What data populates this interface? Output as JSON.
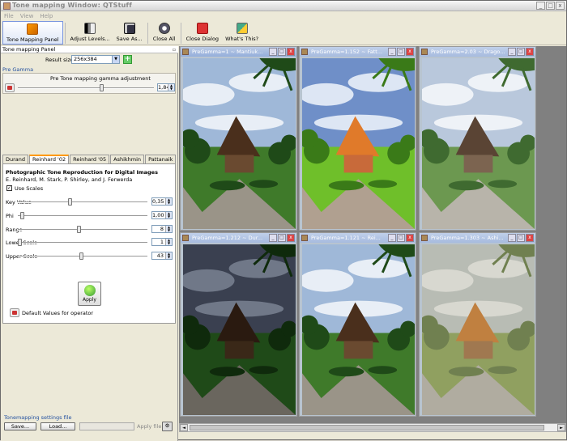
{
  "window": {
    "title": "Tone mapping Window: QTStuff"
  },
  "menu": [
    "File",
    "View",
    "Help"
  ],
  "toolbar": [
    {
      "label": "Tone Mapping Panel",
      "icon": "tonemap-panel-icon",
      "active": true
    },
    {
      "label": "Adjust Levels...",
      "icon": "levels-icon"
    },
    {
      "label": "Save As...",
      "icon": "save-icon"
    },
    {
      "label": "Close All",
      "icon": "close-all-icon"
    },
    {
      "label": "Close Dialog",
      "icon": "power-icon"
    },
    {
      "label": "What's This?",
      "icon": "whats-this-icon"
    }
  ],
  "panel": {
    "title": "Tone mapping Panel",
    "result_size_label": "Result size:",
    "result_size_value": "256x384",
    "pregamma_title": "Pre Gamma",
    "pregamma_caption": "Pre Tone mapping gamma adjustment",
    "pregamma_value": "1,848",
    "pregamma_level": 0.62
  },
  "tabs": [
    "Durand",
    "Reinhard '02",
    "Reinhard '05",
    "Ashikhmin",
    "Pattanaik"
  ],
  "operator": {
    "title": "Photographic Tone Reproduction for Digital Images",
    "authors": "E. Reinhard, M. Stark, P. Shirley, and J. Ferwerda",
    "use_scales": "Use Scales",
    "params": [
      {
        "label": "Key Value",
        "value": "0,35",
        "level": 0.4
      },
      {
        "label": "Phi",
        "value": "1,00",
        "level": 0.02
      },
      {
        "label": "Range",
        "value": "8",
        "level": 0.47
      },
      {
        "label": "Lower Scale",
        "value": "1",
        "level": 0.0
      },
      {
        "label": "Upper Scale",
        "value": "43",
        "level": 0.49
      }
    ],
    "defaults_label": "Default Values for operator"
  },
  "apply_label": "Apply",
  "settings": {
    "title": "Tonemapping settings file",
    "save": "Save...",
    "load": "Load...",
    "apply_file": "Apply file"
  },
  "subwindows": [
    {
      "title": "PreGamma=1 ~ Mantiuk...",
      "tone": "normal"
    },
    {
      "title": "PreGamma=1.152 ~ Fatt...",
      "tone": "vivid"
    },
    {
      "title": "PreGamma=2.03 ~ Drago...",
      "tone": "pale"
    },
    {
      "title": "PreGamma=1.212 ~ Dur...",
      "tone": "dark"
    },
    {
      "title": "PreGamma=1.121 ~ Rei...",
      "tone": "normal"
    },
    {
      "title": "PreGamma=1.303 ~ Ashi...",
      "tone": "washed"
    }
  ]
}
